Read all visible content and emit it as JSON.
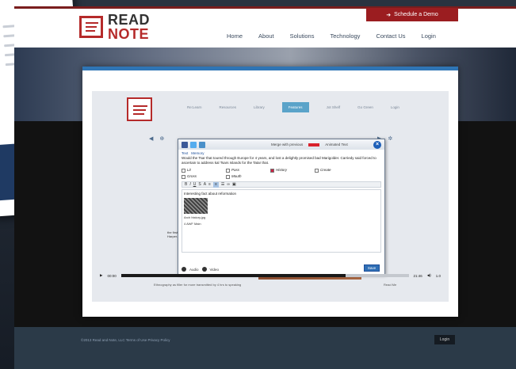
{
  "header": {
    "logo_line1": "READ",
    "logo_line2": "NOTE",
    "schedule_label": "Schedule a Demo",
    "nav": [
      "Home",
      "About",
      "Solutions",
      "Technology",
      "Contact Us",
      "Login"
    ]
  },
  "video": {
    "nav": [
      "Re:Learn",
      "Resources",
      "Library",
      "Features",
      "Jot Shelf",
      "Go Green",
      "Login"
    ],
    "active_nav_index": 3,
    "dialog": {
      "title": "Merge with previous",
      "title2": "Animated Text",
      "tabs": [
        "Text",
        "Memory"
      ],
      "quote": "Would the Tsar that toured through Europe for 4 years, and lost a delightly promised bad Marigolder. Carriedy said forced to ascertain to address kal Tsars Islands for the Tatar that.",
      "categories": [
        "Lit",
        "Pass",
        "History",
        "Create",
        "Gross",
        "Mouth"
      ],
      "editor_text": "Interesting fact about reformation",
      "attachment": "Arch history.jpg",
      "attachment2": "4 AWF Main",
      "footer_audio": "Audio",
      "footer_video": "Video",
      "save_label": "Save"
    },
    "book_text": "the first Greeners who Terrynor and those Anna Ayers ~ and the the same connected phoneticals Pleasant and Harper. Looking to The",
    "player": {
      "time_left": "00:00",
      "time_right": "21:46",
      "speed": "1.0",
      "progress": 0.78
    },
    "caption_left": "Ethnography as filler for more transmitted by 4 hrs to speaking",
    "caption_right": "Read Me"
  },
  "footer": {
    "copyright": "©2013 Read and Note, LLC  Terms of Use  Privacy Policy",
    "login": "Login"
  },
  "colors": {
    "brand_red": "#b52a2a",
    "schedule_bg": "#9b1d20",
    "video_border": "#2f75b5",
    "footer_bg": "#2b3a48"
  }
}
